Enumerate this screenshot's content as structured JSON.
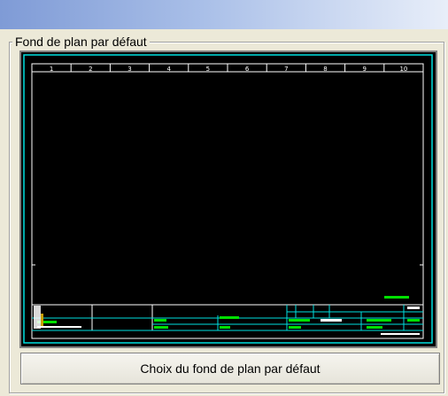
{
  "window": {
    "title": ""
  },
  "group": {
    "legend": "Fond de plan par défaut"
  },
  "preview": {
    "columns": [
      "1",
      "2",
      "3",
      "4",
      "5",
      "6",
      "7",
      "8",
      "9",
      "10"
    ],
    "colors": {
      "frame": "#00e0e0",
      "lines": "#ffffff",
      "text": "#00e000",
      "bg": "#000000"
    }
  },
  "button": {
    "label": "Choix du fond de plan par défaut"
  }
}
